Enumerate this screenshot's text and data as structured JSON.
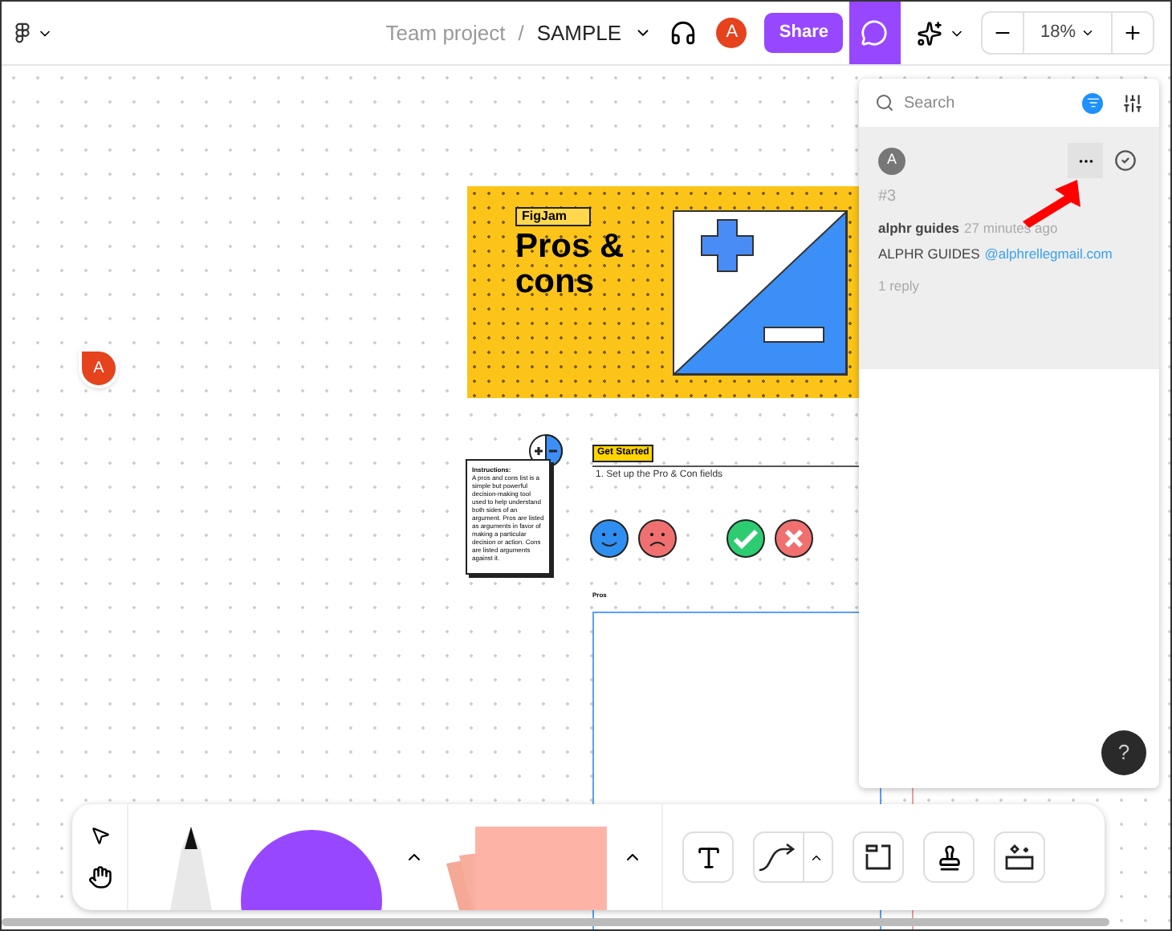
{
  "top_bar": {
    "project": "Team project",
    "separator": "/",
    "file": "SAMPLE",
    "avatar": "A",
    "share": "Share",
    "comments_open": true,
    "zoom": "18%"
  },
  "canvas": {
    "pin": "A",
    "board": {
      "label": "FigJam",
      "title": "Pros & cons"
    },
    "instructions": {
      "heading": "Instructions:",
      "body": "A pros and cons list is a simple but powerful decision-making tool used to help understand both sides of an argument. Pros are listed as arguments in favor of making a particular decision or action. Cons are listed arguments against it."
    },
    "get_started": "Get Started",
    "step": "1. Set up the Pro & Con fields",
    "pros_label": "Pros"
  },
  "comments": {
    "placeholder": "Search",
    "items": [
      {
        "avatar": "A",
        "number": "#3",
        "author": "alphr guides",
        "time": "27 minutes ago",
        "message": "ALPHR GUIDES",
        "mention": "@alphrellegmail.com",
        "replies": "1 reply"
      }
    ]
  },
  "help": "?"
}
